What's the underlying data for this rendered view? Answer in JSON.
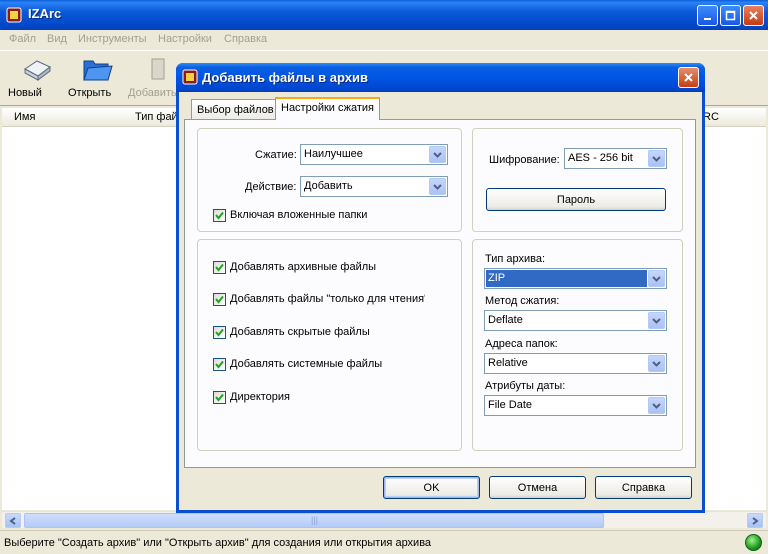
{
  "app": {
    "title": "IZArc",
    "menu": [
      "Файл",
      "Вид",
      "Инструменты",
      "Настройки",
      "Справка"
    ],
    "toolbar": {
      "new_label": "Новый",
      "open_label": "Открыть",
      "add_label": "Добавить"
    },
    "columns": {
      "name": "Имя",
      "type": "Тип файл",
      "crc": "RC"
    },
    "status_text": "Выберите \"Создать архив\" или \"Открыть архив\" для создания или открытия архива",
    "scroll_grip": "|||"
  },
  "dialog": {
    "title": "Добавить файлы в архив",
    "tabs": [
      "Выбор файлов",
      "Настройки сжатия"
    ],
    "compression_label": "Сжатие:",
    "compression_value": "Наилучшее",
    "action_label": "Действие:",
    "action_value": "Добавить",
    "include_subfolders": "Включая вложенные папки",
    "encryption_label": "Шифрование:",
    "encryption_value": "AES - 256 bit",
    "password_button": "Пароль",
    "options": [
      "Добавлять архивные файлы",
      "Добавлять файлы \"только для чтения\"",
      "Добавлять скрытые файлы",
      "Добавлять системные файлы",
      "Директория"
    ],
    "archive_type_label": "Тип архива:",
    "archive_type_value": "ZIP",
    "method_label": "Метод сжатия:",
    "method_value": "Deflate",
    "folder_paths_label": "Адреса папок:",
    "folder_paths_value": "Relative",
    "date_attr_label": "Атрибуты даты:",
    "date_attr_value": "File Date",
    "ok_button": "OK",
    "cancel_button": "Отмена",
    "help_button": "Справка"
  },
  "colors": {
    "title_blue": "#0055e5",
    "selection": "#316ac5",
    "check": "#21a121"
  }
}
